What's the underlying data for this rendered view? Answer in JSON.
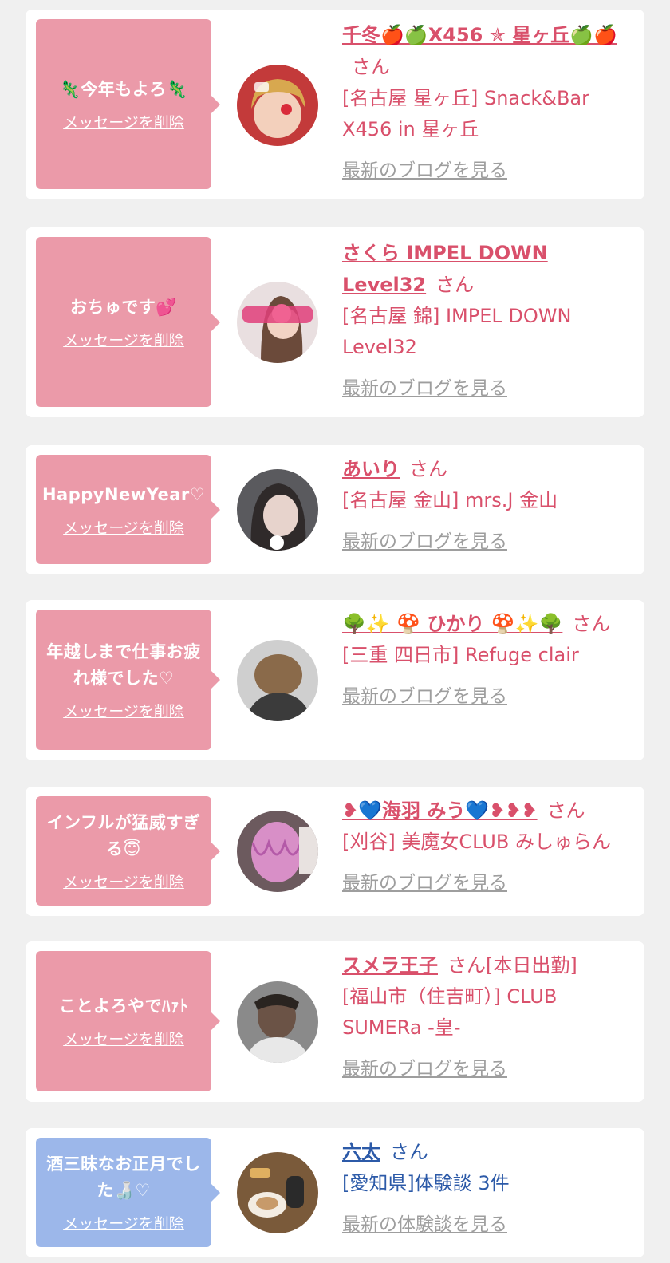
{
  "colors": {
    "pink_bubble": "#eb9aa9",
    "blue_bubble": "#9cb7ea",
    "pink_text": "#d9506b",
    "blue_text": "#2c5aa8",
    "link_gray": "#9e9e9e",
    "page_bg": "#f0f0f0"
  },
  "delete_label": "メッセージを削除",
  "cards": [
    {
      "message": "🦎今年もよろ🦎",
      "name": "千冬🍎🍏X456 ✯ 星ヶ丘🍏🍎",
      "suffix": "さん",
      "shop": "[名古屋 星ヶ丘] Snack&Bar X456 in 星ヶ丘",
      "blog": "最新のブログを見る",
      "avatar_icon": "avatar-photo"
    },
    {
      "message": "おちゅです💕",
      "name": "さくら IMPEL DOWN Level32",
      "suffix": "さん",
      "shop": "[名古屋 錦] IMPEL DOWN Level32",
      "blog": "最新のブログを見る",
      "avatar_icon": "avatar-photo"
    },
    {
      "message": "HappyNewYear♡",
      "name": "あいり",
      "suffix": "さん",
      "shop": "[名古屋 金山] mrs.J 金山",
      "blog": "最新のブログを見る",
      "avatar_icon": "avatar-photo"
    },
    {
      "message": "年越しまで仕事お疲れ様でした♡",
      "name": "🌳✨ 🍄 ひかり 🍄✨🌳",
      "suffix": "さん",
      "shop": "[三重 四日市] Refuge clair",
      "blog": "最新のブログを見る",
      "avatar_icon": "avatar-photo"
    },
    {
      "message": "インフルが猛威すぎる😇",
      "name": "❥💙海羽 みう💙❥❥❥",
      "suffix": "さん",
      "shop": "[刈谷] 美魔女CLUB みしゅらん",
      "blog": "最新のブログを見る",
      "avatar_icon": "avatar-photo"
    },
    {
      "message": "ことよろやでﾊｧﾄ",
      "name": "スメラ王子",
      "suffix": "さん[本日出勤]",
      "shop": "[福山市（住吉町）] CLUB SUMERa -皇-",
      "blog": "最新のブログを見る",
      "avatar_icon": "avatar-photo"
    },
    {
      "message": "酒三昧なお正月でした🍶♡",
      "name": "六太",
      "suffix": "さん",
      "shop": "[愛知県]体験談 3件",
      "blog": "最新の体験談を見る",
      "avatar_icon": "avatar-photo"
    }
  ]
}
